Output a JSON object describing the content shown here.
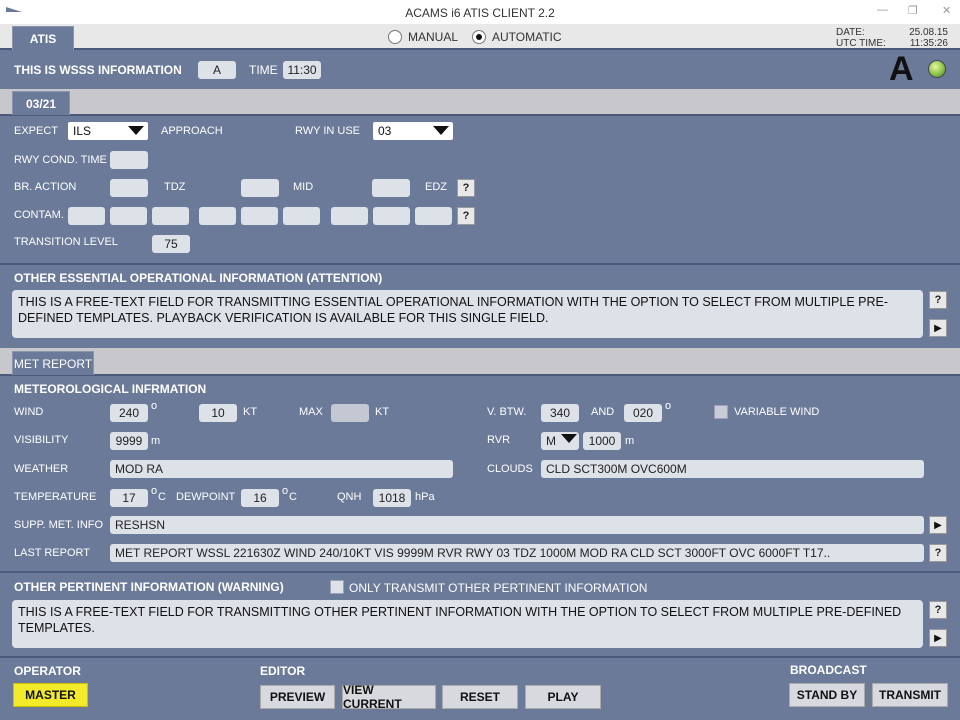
{
  "window": {
    "title": "ACAMS i6 ATIS CLIENT 2.2"
  },
  "top": {
    "tab_atis": "ATIS",
    "mode_manual": "MANUAL",
    "mode_automatic": "AUTOMATIC",
    "date_label": "DATE:",
    "date_value": "25.08.15",
    "utc_label": "UTC TIME:",
    "utc_value": "11:35:26"
  },
  "info": {
    "label": "THIS IS WSSS INFORMATION",
    "letter": "A",
    "time_label": "TIME",
    "time_value": "11:30",
    "big_letter": "A"
  },
  "rwy_tab": "03/21",
  "runway": {
    "expect_label": "EXPECT",
    "expect_value": "ILS",
    "approach_label": "APPROACH",
    "rwy_in_use_label": "RWY IN USE",
    "rwy_in_use_value": "03",
    "cond_time_label": "RWY COND. TIME",
    "br_action_label": "BR. ACTION",
    "tdz_label": "TDZ",
    "mid_label": "MID",
    "edz_label": "EDZ",
    "contam_label": "CONTAM.",
    "transition_label": "TRANSITION LEVEL",
    "transition_value": "75",
    "help": "?"
  },
  "essential": {
    "title": "OTHER ESSENTIAL OPERATIONAL INFORMATION (ATTENTION)",
    "text": "THIS IS A FREE-TEXT FIELD FOR TRANSMITTING ESSENTIAL OPERATIONAL INFORMATION WITH THE OPTION TO SELECT FROM MULTIPLE PRE-DEFINED TEMPLATES. PLAYBACK VERIFICATION IS AVAILABLE FOR THIS SINGLE FIELD."
  },
  "met": {
    "tab": "MET REPORT",
    "title": "METEOROLOGICAL INFRMATION",
    "wind_label": "WIND",
    "wind_dir": "240",
    "deg": "o",
    "wind_speed": "10",
    "kt": "KT",
    "max_label": "MAX",
    "vbtw_label": "V. BTW.",
    "vbtw_from": "340",
    "and_label": "AND",
    "vbtw_to": "020",
    "variable_wind_label": "VARIABLE WIND",
    "visibility_label": "VISIBILITY",
    "visibility_value": "9999",
    "m": "m",
    "rvr_label": "RVR",
    "rvr_mode": "M",
    "rvr_value": "1000",
    "weather_label": "WEATHER",
    "weather_value": "MOD RA",
    "clouds_label": "CLOUDS",
    "clouds_value": "CLD SCT300M OVC600M",
    "temp_label": "TEMPERATURE",
    "temp_value": "17",
    "c_unit": "C",
    "dewpoint_label": "DEWPOINT",
    "dewpoint_value": "16",
    "qnh_label": "QNH",
    "qnh_value": "1018",
    "hpa": "hPa",
    "supp_label": "SUPP. MET. INFO",
    "supp_value": "RESHSN",
    "last_label": "LAST REPORT",
    "last_value": "MET REPORT WSSL 221630Z WIND 240/10KT VIS 9999M RVR RWY 03 TDZ 1000M MOD RA CLD SCT 3000FT OVC 6000FT T17.."
  },
  "pertinent": {
    "title": "OTHER PERTINENT INFORMATION (WARNING)",
    "only_label": "ONLY TRANSMIT OTHER PERTINENT INFORMATION",
    "text": "THIS IS A FREE-TEXT FIELD FOR TRANSMITTING OTHER PERTINENT INFORMATION WITH THE OPTION TO SELECT FROM MULTIPLE PRE-DEFINED TEMPLATES."
  },
  "footer": {
    "operator_label": "OPERATOR",
    "master": "MASTER",
    "editor_label": "EDITOR",
    "preview": "PREVIEW",
    "view_current": "VIEW CURRENT",
    "reset": "RESET",
    "play": "PLAY",
    "broadcast_label": "BROADCAST",
    "stand_by": "STAND BY",
    "transmit": "TRANSMIT"
  },
  "colors": {
    "panel": "#6b7a99",
    "field": "#dde1e8",
    "master": "#f2ea2a",
    "status_led": "#8bc34a"
  }
}
